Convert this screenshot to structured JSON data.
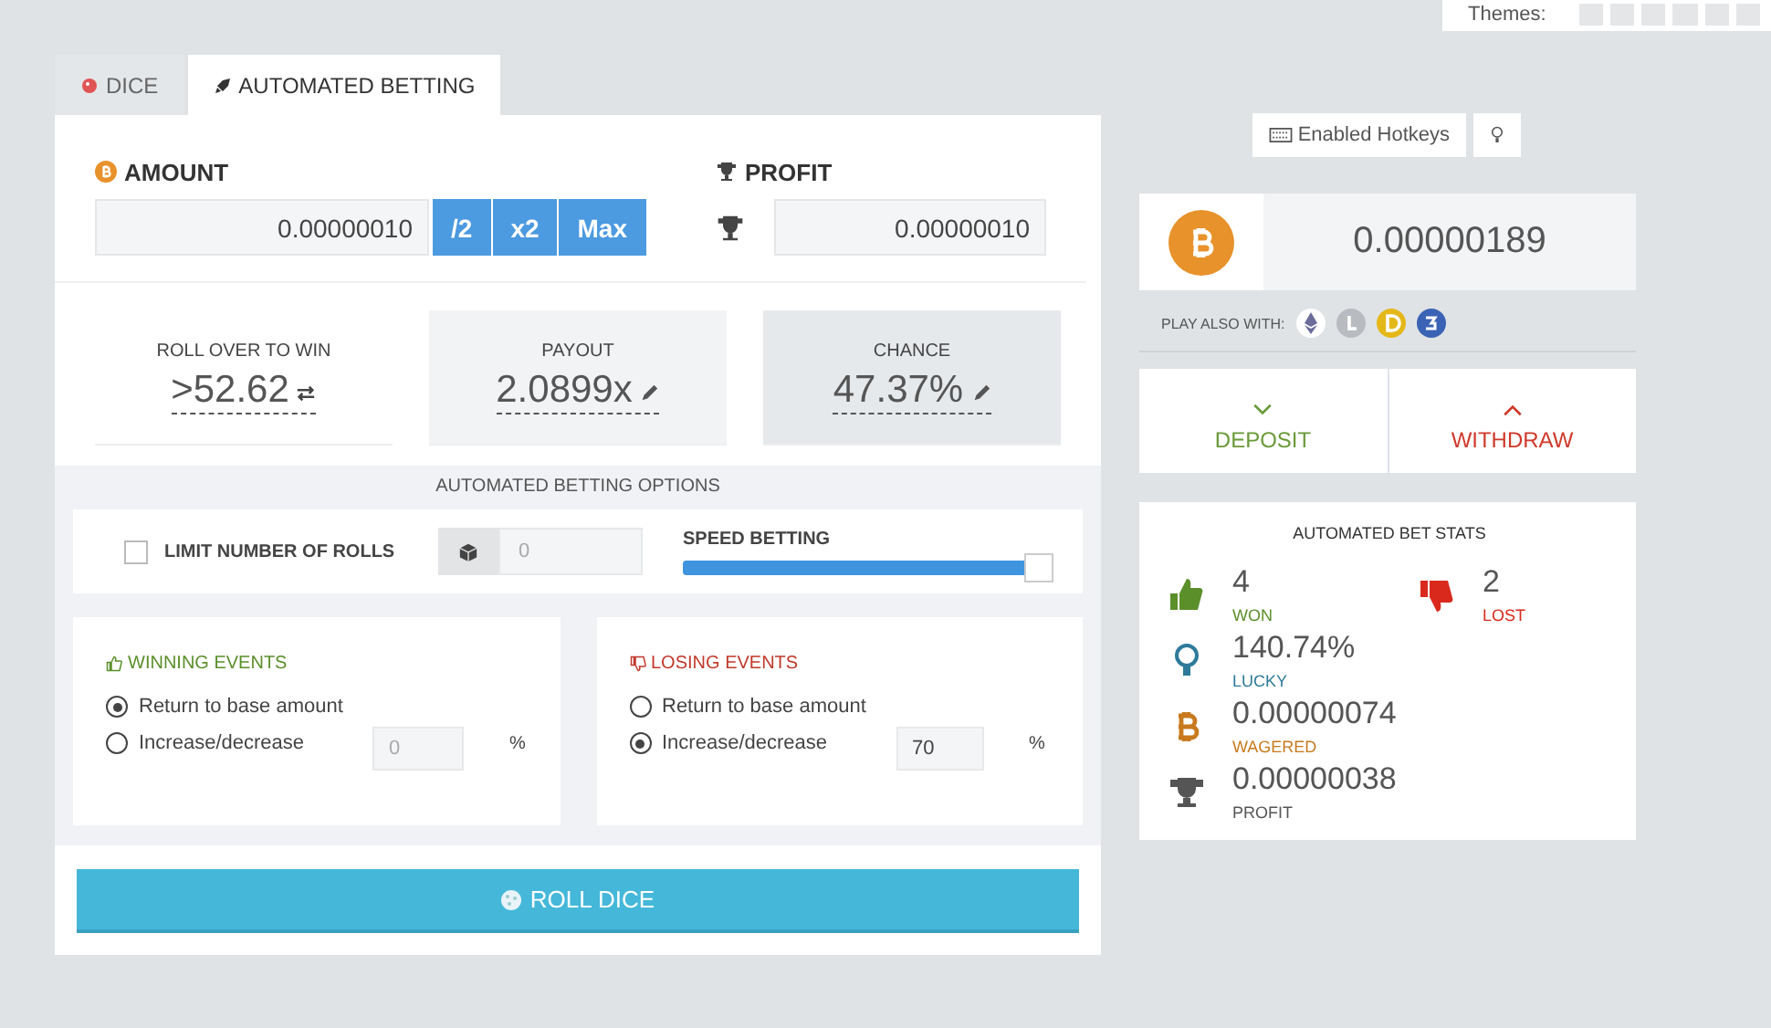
{
  "themes_label": "Themes:",
  "tabs": [
    {
      "label": "DICE",
      "selected": false
    },
    {
      "label": "AUTOMATED BETTING",
      "selected": true
    }
  ],
  "amount": {
    "label": "AMOUNT",
    "value": "0.00000010",
    "buttons": [
      "/2",
      "x2",
      "Max"
    ]
  },
  "profit": {
    "label": "PROFIT",
    "value": "0.00000010"
  },
  "bet_boxes": [
    {
      "label": "ROLL OVER TO WIN",
      "value": ">52.62",
      "kind": "swap"
    },
    {
      "label": "PAYOUT",
      "value": "2.0899x",
      "kind": "edit"
    },
    {
      "label": "CHANCE",
      "value": "47.37%",
      "kind": "edit"
    }
  ],
  "options": {
    "title": "AUTOMATED BETTING OPTIONS",
    "limit_rolls": {
      "label": "LIMIT NUMBER OF ROLLS",
      "checked": false,
      "placeholder": "0"
    },
    "speed": {
      "label": "SPEED BETTING",
      "level": 0.97
    }
  },
  "events": [
    {
      "title": "WINNING EVENTS",
      "kind": "win",
      "choices": [
        {
          "label": "Return to base amount",
          "selected": true
        },
        {
          "label": "Increase/decrease",
          "selected": false
        }
      ],
      "placeholder": "0",
      "unit": "%"
    },
    {
      "title": "LOSING EVENTS",
      "kind": "lose",
      "choices": [
        {
          "label": "Return to base amount",
          "selected": false
        },
        {
          "label": "Increase/decrease",
          "selected": true
        }
      ],
      "value": "70",
      "unit": "%"
    }
  ],
  "roll_button": "ROLL DICE",
  "hotkeys_button": "Enabled Hotkeys",
  "balance": "0.00000189",
  "play_also": "PLAY ALSO WITH:",
  "deposit": "DEPOSIT",
  "withdraw": "WITHDRAW",
  "bet_stats": {
    "title": "AUTOMATED BET STATS",
    "items": [
      {
        "kind": "won",
        "value": "4",
        "label": "WON"
      },
      {
        "kind": "lost",
        "value": "2",
        "label": "LOST"
      },
      {
        "kind": "lucky",
        "value": "140.74%",
        "label": "LUCKY"
      },
      {
        "kind": "wagered",
        "value": "0.00000074",
        "label": "WAGERED"
      },
      {
        "kind": "profit",
        "value": "0.00000038",
        "label": "PROFIT"
      }
    ]
  }
}
